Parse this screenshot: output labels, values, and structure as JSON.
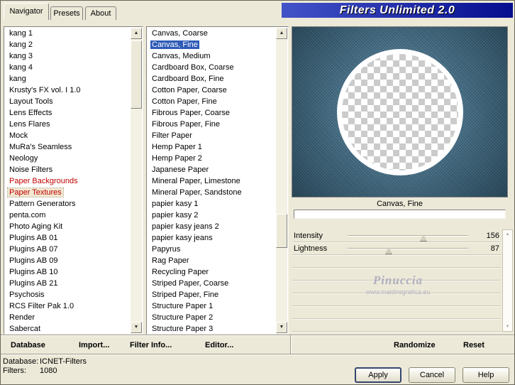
{
  "colors": {
    "window-bg": "#ece9d8",
    "selection-blue": "#2f5bb7",
    "category-red": "#c00000",
    "denim": "#2e5a74",
    "title-grad-start": "#4353c8",
    "title-grad-end": "#050e8e"
  },
  "icons": {
    "up-arrow": "▲",
    "down-arrow": "▼"
  },
  "window": {
    "title": "Filters Unlimited 2.0",
    "tabs": [
      {
        "label": "Navigator",
        "active": true
      },
      {
        "label": "Presets",
        "active": false
      },
      {
        "label": "About",
        "active": false
      }
    ]
  },
  "categories": [
    {
      "label": "kang 1"
    },
    {
      "label": "kang 2"
    },
    {
      "label": "kang 3"
    },
    {
      "label": "kang 4"
    },
    {
      "label": "kang"
    },
    {
      "label": "Krusty's FX vol. I 1.0"
    },
    {
      "label": "Layout Tools"
    },
    {
      "label": "Lens Effects"
    },
    {
      "label": "Lens Flares"
    },
    {
      "label": "Mock"
    },
    {
      "label": "MuRa's Seamless"
    },
    {
      "label": "Neology"
    },
    {
      "label": "Noise Filters"
    },
    {
      "label": "Paper Backgrounds",
      "red": true
    },
    {
      "label": "Paper Textures",
      "red": true,
      "selected": true
    },
    {
      "label": "Pattern Generators"
    },
    {
      "label": "penta.com"
    },
    {
      "label": "Photo Aging Kit"
    },
    {
      "label": "Plugins AB 01"
    },
    {
      "label": "Plugins AB 07"
    },
    {
      "label": "Plugins AB 09"
    },
    {
      "label": "Plugins AB 10"
    },
    {
      "label": "Plugins AB 21"
    },
    {
      "label": "Psychosis"
    },
    {
      "label": "RCS Filter Pak 1.0"
    },
    {
      "label": "Render"
    },
    {
      "label": "Sabercat"
    }
  ],
  "filters": [
    {
      "label": "Canvas, Coarse"
    },
    {
      "label": "Canvas, Fine",
      "selected": true
    },
    {
      "label": "Canvas, Medium"
    },
    {
      "label": "Cardboard Box, Coarse"
    },
    {
      "label": "Cardboard Box, Fine"
    },
    {
      "label": "Cotton Paper, Coarse"
    },
    {
      "label": "Cotton Paper, Fine"
    },
    {
      "label": "Fibrous Paper, Coarse"
    },
    {
      "label": "Fibrous Paper, Fine"
    },
    {
      "label": "Filter Paper"
    },
    {
      "label": "Hemp Paper 1"
    },
    {
      "label": "Hemp Paper 2"
    },
    {
      "label": "Japanese Paper"
    },
    {
      "label": "Mineral Paper, Limestone"
    },
    {
      "label": "Mineral Paper, Sandstone"
    },
    {
      "label": "papier kasy 1"
    },
    {
      "label": "papier kasy 2"
    },
    {
      "label": "papier kasy jeans 2"
    },
    {
      "label": "papier kasy jeans"
    },
    {
      "label": "Papyrus"
    },
    {
      "label": "Rag Paper"
    },
    {
      "label": "Recycling Paper"
    },
    {
      "label": "Striped Paper, Coarse"
    },
    {
      "label": "Striped Paper, Fine"
    },
    {
      "label": "Structure Paper 1"
    },
    {
      "label": "Structure Paper 2"
    },
    {
      "label": "Structure Paper 3"
    }
  ],
  "preview": {
    "caption": "Canvas, Fine",
    "watermark_title": "Pinuccia",
    "watermark_url": "www.maidiregrafica.eu"
  },
  "params": [
    {
      "label": "Intensity",
      "value": 156,
      "max": 255
    },
    {
      "label": "Lightness",
      "value": 87,
      "max": 255
    }
  ],
  "toolbar": {
    "database": "Database",
    "import": "Import...",
    "filter_info": "Filter Info...",
    "editor": "Editor...",
    "randomize": "Randomize",
    "reset": "Reset"
  },
  "statusbar": {
    "database_label": "Database:",
    "database_value": "ICNET-Filters",
    "filters_label": "Filters:",
    "filters_value": "1080"
  },
  "actions": {
    "apply": "Apply",
    "cancel": "Cancel",
    "help": "Help"
  }
}
